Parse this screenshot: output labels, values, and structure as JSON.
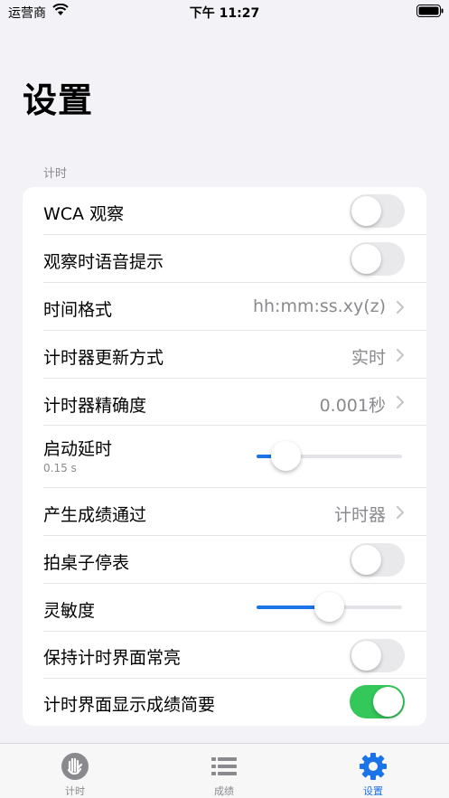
{
  "status_bar": {
    "carrier": "运营商",
    "time": "下午 11:27"
  },
  "title": "设置",
  "section": "计时",
  "rows": {
    "wca": {
      "label": "WCA 观察",
      "toggle": false
    },
    "voice": {
      "label": "观察时语音提示",
      "toggle": false
    },
    "time_format": {
      "label": "时间格式",
      "value": "hh:mm:ss.xy(z)"
    },
    "update_mode": {
      "label": "计时器更新方式",
      "value": "实时"
    },
    "precision": {
      "label": "计时器精确度",
      "value": "0.001秒"
    },
    "start_delay": {
      "label": "启动延时",
      "sublabel": "0.15 s",
      "slider_fraction": 0.2
    },
    "result_by": {
      "label": "产生成绩通过",
      "value": "计时器"
    },
    "tap_stop": {
      "label": "拍桌子停表",
      "toggle": false
    },
    "sensitivity": {
      "label": "灵敏度",
      "slider_fraction": 0.5
    },
    "keep_awake": {
      "label": "保持计时界面常亮",
      "toggle": false
    },
    "show_summary": {
      "label": "计时界面显示成绩简要",
      "toggle": true
    }
  },
  "tabs": [
    {
      "label": "计时",
      "icon": "hand-timer-icon",
      "active": false
    },
    {
      "label": "成绩",
      "icon": "list-icon",
      "active": false
    },
    {
      "label": "设置",
      "icon": "gear-icon",
      "active": true
    }
  ],
  "colors": {
    "accent": "#1a73e8",
    "toggle_on": "#34c759",
    "background": "#f2f2f7"
  }
}
